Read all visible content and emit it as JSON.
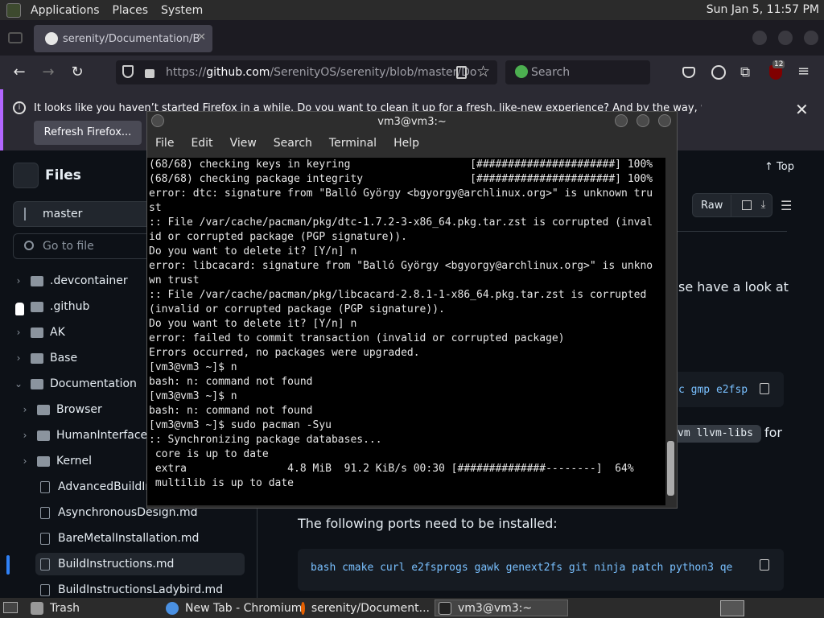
{
  "top_panel": {
    "menus": [
      "Applications",
      "Places",
      "System"
    ],
    "clock": "Sun Jan  5, 11:57 PM"
  },
  "firefox": {
    "tab_title": "serenity/Documentation/Bu",
    "url_prefix": "https://",
    "url_host": "github.com",
    "url_path": "/SerenityOS/serenity/blob/master/Do",
    "search_placeholder": "Search",
    "badge_count": "12",
    "notification": "It looks like you haven’t started Firefox in a while. Do you want to clean it up for a fresh, like-new experience? And by the way, welcome back!",
    "refresh_button": "Refresh Firefox..."
  },
  "github": {
    "files_title": "Files",
    "branch": "master",
    "goto_placeholder": "Go to file",
    "tree": [
      {
        "label": ".devcontainer",
        "type": "folder"
      },
      {
        "label": ".github",
        "type": "folder"
      },
      {
        "label": "AK",
        "type": "folder"
      },
      {
        "label": "Base",
        "type": "folder"
      },
      {
        "label": "Documentation",
        "type": "folder-open"
      },
      {
        "label": "Browser",
        "type": "folder"
      },
      {
        "label": "HumanInterfaceG",
        "type": "folder"
      },
      {
        "label": "Kernel",
        "type": "folder"
      },
      {
        "label": "AdvancedBuildIns",
        "type": "file"
      },
      {
        "label": "AsynchronousDesign.md",
        "type": "file"
      },
      {
        "label": "BareMetalInstallation.md",
        "type": "file"
      },
      {
        "label": "BuildInstructions.md",
        "type": "file"
      },
      {
        "label": "BuildInstructionsLadybird.md",
        "type": "file"
      }
    ],
    "top_link": "Top",
    "raw_label": "Raw",
    "frag_look": "se have a look at",
    "frag_code1": "c gmp e2fsp",
    "frag_pill": "vm llvm-libs",
    "frag_for": "for",
    "ports_heading": "The following ports need to be installed:",
    "ports_code": "bash cmake curl e2fsprogs gawk genext2fs git ninja patch python3 qe"
  },
  "terminal": {
    "title": "vm3@vm3:~",
    "menus": [
      "File",
      "Edit",
      "View",
      "Search",
      "Terminal",
      "Help"
    ],
    "output": "(68/68) checking keys in keyring                   [######################] 100%\n(68/68) checking package integrity                 [######################] 100%\nerror: dtc: signature from \"Balló György <bgyorgy@archlinux.org>\" is unknown tru\nst\n:: File /var/cache/pacman/pkg/dtc-1.7.2-3-x86_64.pkg.tar.zst is corrupted (inval\nid or corrupted package (PGP signature)).\nDo you want to delete it? [Y/n] n\nerror: libcacard: signature from \"Balló György <bgyorgy@archlinux.org>\" is unkno\nwn trust\n:: File /var/cache/pacman/pkg/libcacard-2.8.1-1-x86_64.pkg.tar.zst is corrupted\n(invalid or corrupted package (PGP signature)).\nDo you want to delete it? [Y/n] n\nerror: failed to commit transaction (invalid or corrupted package)\nErrors occurred, no packages were upgraded.\n[vm3@vm3 ~]$ n\nbash: n: command not found\n[vm3@vm3 ~]$ n\nbash: n: command not found\n[vm3@vm3 ~]$ sudo pacman -Syu\n:: Synchronizing package databases...\n core is up to date\n extra                4.8 MiB  91.2 KiB/s 00:30 [##############--------]  64%\n multilib is up to date"
  },
  "taskbar": {
    "items": [
      {
        "label": "Trash"
      },
      {
        "label": "New Tab - Chromium"
      },
      {
        "label": "serenity/Document..."
      },
      {
        "label": "vm3@vm3:~"
      }
    ]
  }
}
